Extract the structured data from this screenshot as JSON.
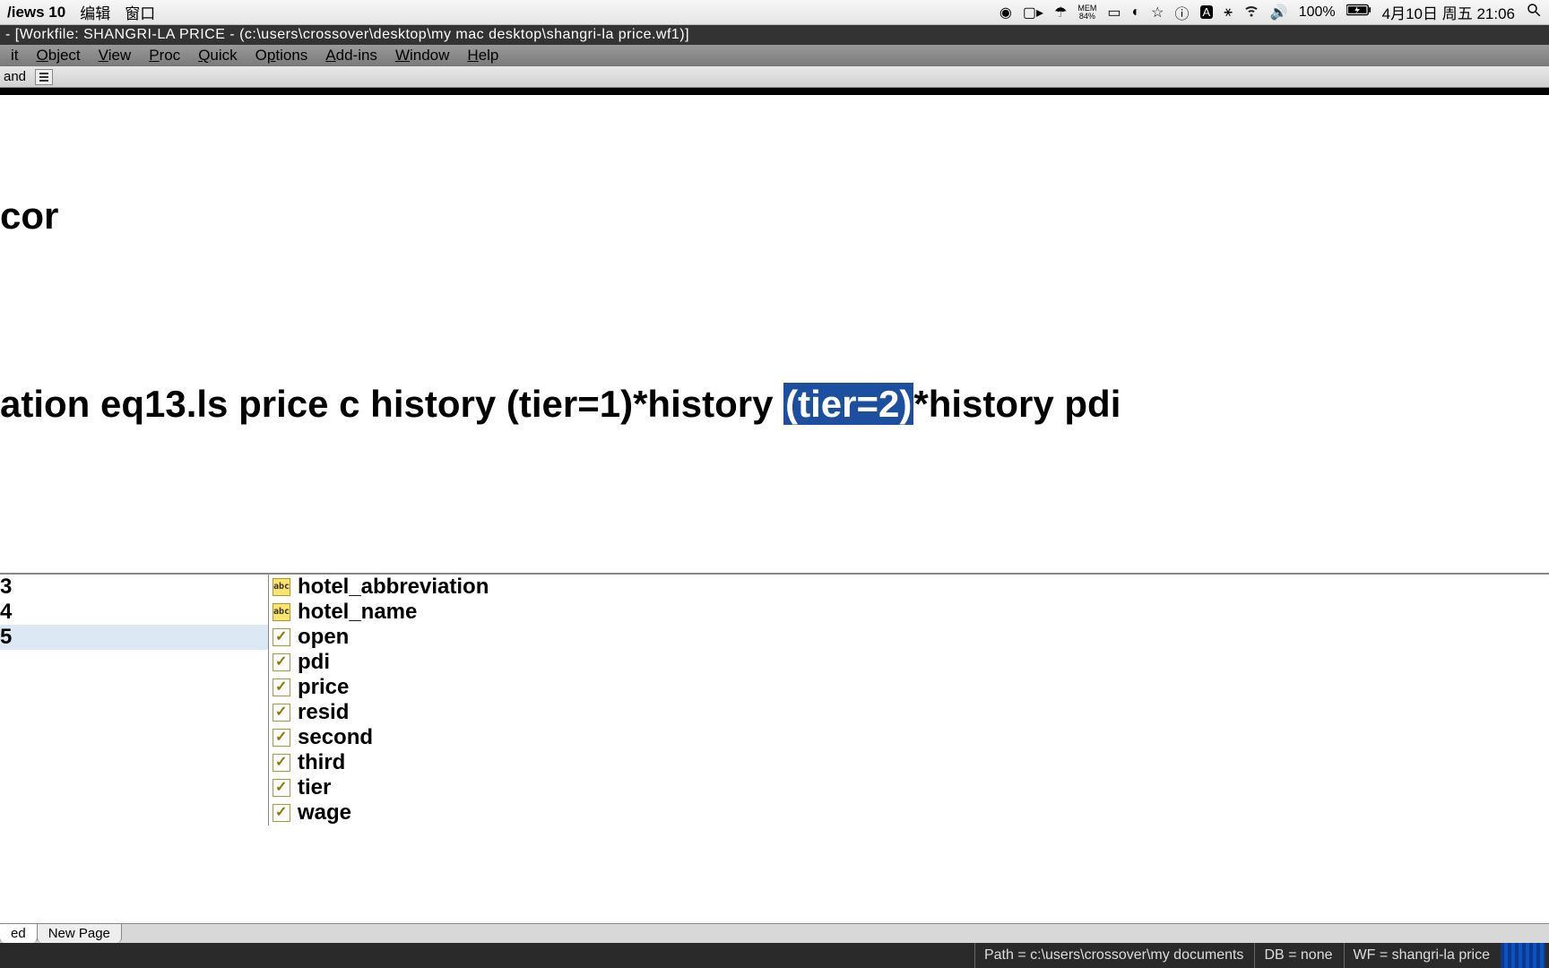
{
  "mac_menubar": {
    "app_name": "/iews 10",
    "menus": [
      "编辑",
      "窗口"
    ],
    "mem_label": "MEM",
    "mem_value": "84%",
    "battery_percent": "100%",
    "datetime": "4月10日 周五 21:06"
  },
  "window": {
    "title": " - [Workfile: SHANGRI-LA PRICE - (c:\\users\\crossover\\desktop\\my mac desktop\\shangri-la price.wf1)]"
  },
  "app_menu": {
    "items": [
      {
        "u": "",
        "rest": "it"
      },
      {
        "u": "O",
        "rest": "bject"
      },
      {
        "u": "V",
        "rest": "iew"
      },
      {
        "u": "P",
        "rest": "roc"
      },
      {
        "u": "Q",
        "rest": "uick"
      },
      {
        "u": "",
        "rest": "O"
      },
      {
        "u": "A",
        "rest": "dd-ins"
      },
      {
        "u": "W",
        "rest": "indow"
      },
      {
        "u": "H",
        "rest": "elp"
      }
    ],
    "labels": [
      "it",
      "Object",
      "View",
      "Proc",
      "Quick",
      "Options",
      "Add-ins",
      "Window",
      "Help"
    ]
  },
  "toolbar": {
    "command_label": "and"
  },
  "command": {
    "line1": "cor",
    "line2_before_sel": "ation eq13.ls price c history (tier=1)*history ",
    "line2_sel": "(tier=2)",
    "line2_after_sel": "*history pdi"
  },
  "left_numbers": [
    "3",
    "4",
    "5"
  ],
  "left_selected_index": 2,
  "objects": [
    {
      "type": "abc",
      "name": "hotel_abbreviation"
    },
    {
      "type": "abc",
      "name": "hotel_name"
    },
    {
      "type": "series",
      "name": "open"
    },
    {
      "type": "series",
      "name": "pdi"
    },
    {
      "type": "series",
      "name": "price"
    },
    {
      "type": "series",
      "name": "resid"
    },
    {
      "type": "series",
      "name": "second"
    },
    {
      "type": "series",
      "name": "third"
    },
    {
      "type": "series",
      "name": "tier"
    },
    {
      "type": "series",
      "name": "wage"
    }
  ],
  "page_tabs": {
    "tabs": [
      {
        "label": "ed",
        "active": true
      },
      {
        "label": "New Page",
        "active": false
      }
    ]
  },
  "status": {
    "path": "Path = c:\\users\\crossover\\my documents",
    "db": "DB = none",
    "wf": "WF = shangri-la price"
  }
}
